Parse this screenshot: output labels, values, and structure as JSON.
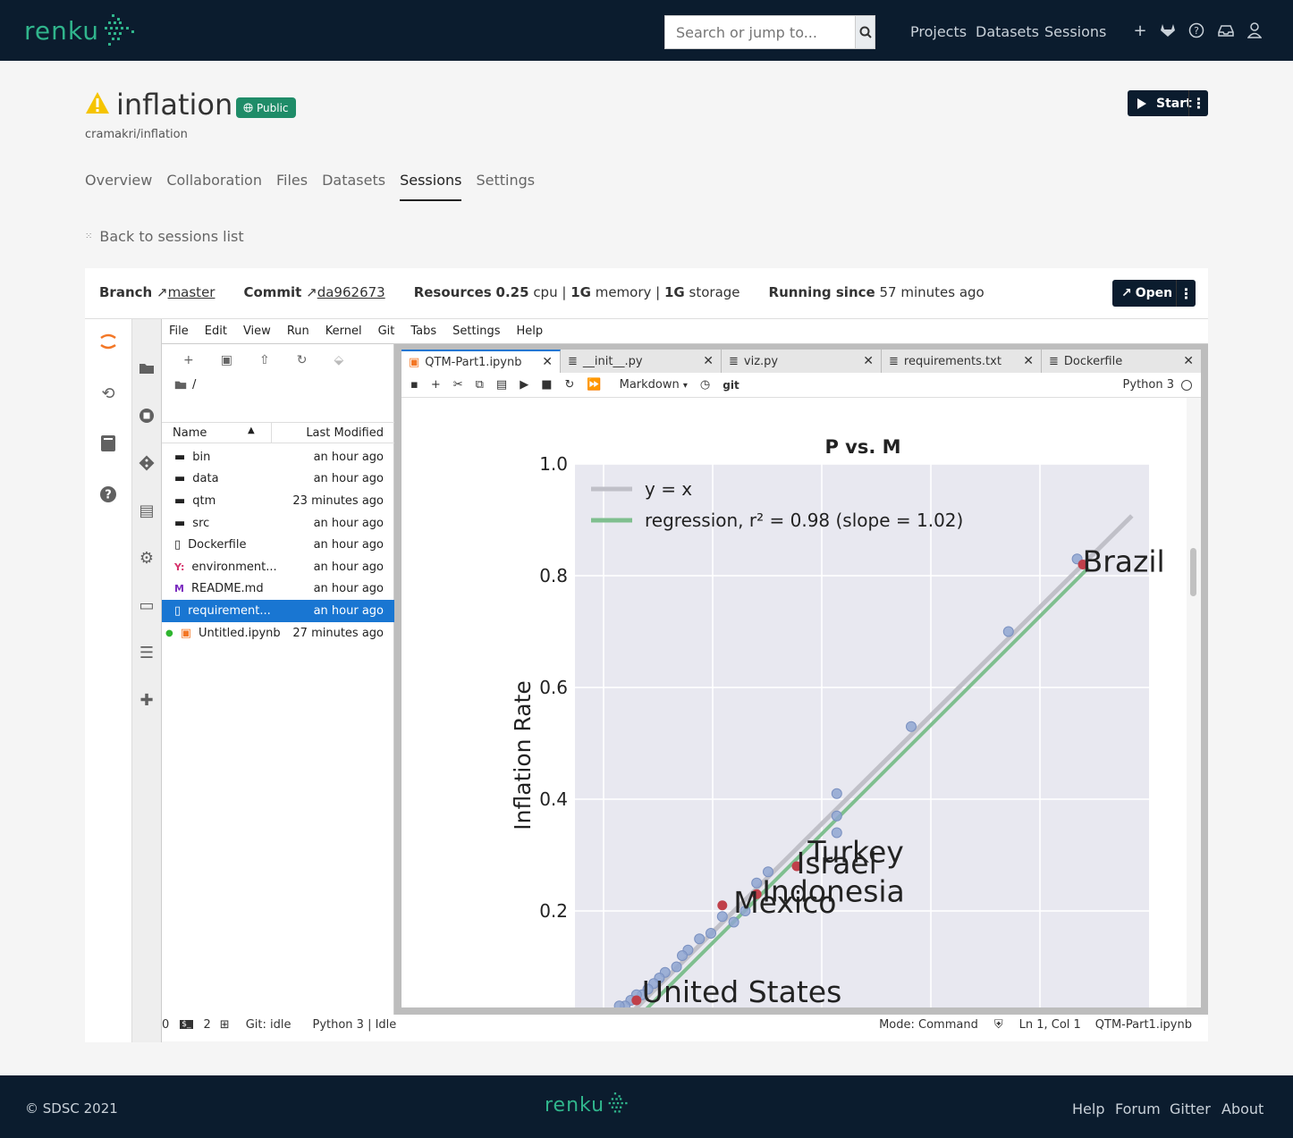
{
  "nav": {
    "logo": "renku",
    "search_placeholder": "Search or jump to...",
    "links": [
      "Projects",
      "Datasets",
      "Sessions"
    ],
    "icons": [
      "plus-icon",
      "gitlab-icon",
      "help-icon",
      "inbox-icon",
      "user-icon"
    ]
  },
  "project": {
    "title": "inflation",
    "visibility": "Public",
    "path": "cramakri/inflation",
    "start_label": "Start",
    "tabs": [
      "Overview",
      "Collaboration",
      "Files",
      "Datasets",
      "Sessions",
      "Settings"
    ],
    "active_tab": "Sessions",
    "back_label": "Back to sessions list"
  },
  "session": {
    "branch_label": "Branch",
    "branch": "master",
    "commit_label": "Commit",
    "commit": "da962673",
    "resources_label": "Resources",
    "cpu_value": "0.25",
    "cpu_unit": "cpu",
    "mem_value": "1G",
    "mem_unit": "memory",
    "storage_value": "1G",
    "storage_unit": "storage",
    "running_label": "Running since",
    "running": "57 minutes ago",
    "open_label": "Open"
  },
  "jupyter": {
    "menu": [
      "File",
      "Edit",
      "View",
      "Run",
      "Kernel",
      "Git",
      "Tabs",
      "Settings",
      "Help"
    ],
    "breadcrumb": "/",
    "col_name": "Name",
    "col_modified": "Last Modified",
    "files": [
      {
        "name": "bin",
        "modified": "an hour ago",
        "icon": "folder"
      },
      {
        "name": "data",
        "modified": "an hour ago",
        "icon": "folder"
      },
      {
        "name": "qtm",
        "modified": "23 minutes ago",
        "icon": "folder"
      },
      {
        "name": "src",
        "modified": "an hour ago",
        "icon": "folder"
      },
      {
        "name": "Dockerfile",
        "modified": "an hour ago",
        "icon": "file"
      },
      {
        "name": "environment...",
        "modified": "an hour ago",
        "icon": "yaml"
      },
      {
        "name": "README.md",
        "modified": "an hour ago",
        "icon": "markdown"
      },
      {
        "name": "requirement...",
        "modified": "an hour ago",
        "icon": "file",
        "selected": true
      },
      {
        "name": "Untitled.ipynb",
        "modified": "27 minutes ago",
        "icon": "notebook"
      }
    ],
    "tabs": [
      "QTM-Part1.ipynb",
      "__init__.py",
      "viz.py",
      "requirements.txt",
      "Dockerfile"
    ],
    "cell_type": "Markdown",
    "git_label": "git",
    "kernel": "Python 3",
    "status": {
      "terminals": "0",
      "kernels": "2",
      "git": "Git: idle",
      "kernel_status": "Python 3 | Idle",
      "mode": "Mode: Command",
      "position": "Ln 1, Col 1",
      "file": "QTM-Part1.ipynb"
    }
  },
  "chart_data": {
    "type": "scatter",
    "title": "P vs. M",
    "ylabel": "Inflation Rate",
    "ylim": [
      0.0,
      1.0
    ],
    "yticks": [
      "1.0",
      "0.8",
      "0.6",
      "0.4",
      "0.2"
    ],
    "legend": [
      "y = x",
      "regression, r² = 0.98 (slope = 1.02)"
    ],
    "series": [
      {
        "name": "y = x",
        "color": "#c0c0c8"
      },
      {
        "name": "regression, r² = 0.98 (slope = 1.02)",
        "color": "#7fbf8f"
      }
    ],
    "labels": [
      {
        "text": "Brazil",
        "x": 0.84,
        "y": 0.82
      },
      {
        "text": "Turkey",
        "x": 0.36,
        "y": 0.3
      },
      {
        "text": "Israel",
        "x": 0.34,
        "y": 0.28
      },
      {
        "text": "Indonesia",
        "x": 0.28,
        "y": 0.23
      },
      {
        "text": "Mexico",
        "x": 0.23,
        "y": 0.21
      },
      {
        "text": "United States",
        "x": 0.07,
        "y": 0.05
      }
    ],
    "points": [
      [
        0.84,
        0.83
      ],
      [
        0.72,
        0.7
      ],
      [
        0.55,
        0.53
      ],
      [
        0.42,
        0.41
      ],
      [
        0.42,
        0.37
      ],
      [
        0.42,
        0.34
      ],
      [
        0.3,
        0.27
      ],
      [
        0.28,
        0.25
      ],
      [
        0.26,
        0.2
      ],
      [
        0.24,
        0.18
      ],
      [
        0.22,
        0.19
      ],
      [
        0.2,
        0.16
      ],
      [
        0.18,
        0.15
      ],
      [
        0.16,
        0.13
      ],
      [
        0.15,
        0.12
      ],
      [
        0.14,
        0.1
      ],
      [
        0.12,
        0.09
      ],
      [
        0.11,
        0.08
      ],
      [
        0.1,
        0.07
      ],
      [
        0.09,
        0.06
      ],
      [
        0.08,
        0.05
      ],
      [
        0.07,
        0.05
      ],
      [
        0.06,
        0.04
      ],
      [
        0.05,
        0.03
      ],
      [
        0.04,
        0.03
      ]
    ],
    "highlight": [
      [
        0.85,
        0.82
      ],
      [
        0.35,
        0.28
      ],
      [
        0.28,
        0.23
      ],
      [
        0.22,
        0.21
      ],
      [
        0.07,
        0.04
      ]
    ],
    "colors": {
      "point": "#8fa6d1",
      "highlight": "#c0404a",
      "background": "#e8e8f0"
    }
  },
  "footer": {
    "copyright": "© SDSC 2021",
    "logo": "renku",
    "links": [
      "Help",
      "Forum",
      "Gitter",
      "About"
    ]
  }
}
